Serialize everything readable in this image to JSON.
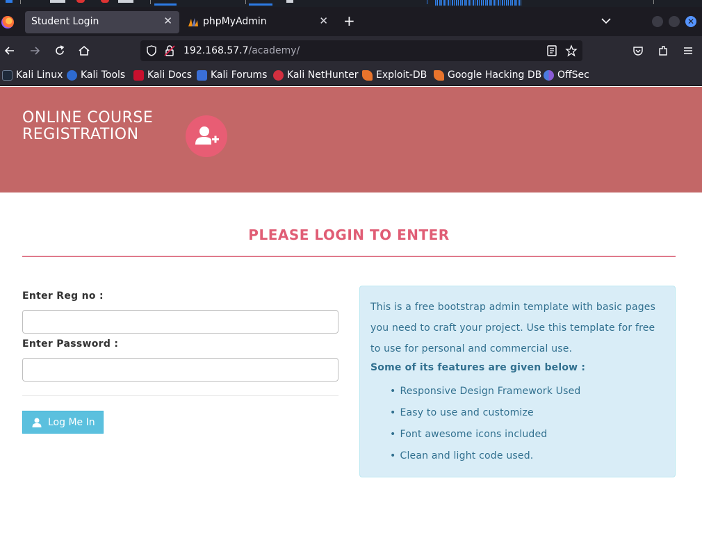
{
  "browser": {
    "tabs": [
      {
        "label": "Student Login",
        "active": true
      },
      {
        "label": "phpMyAdmin",
        "active": false
      }
    ],
    "url_host": "192.168.57.7",
    "url_path": "/academy/",
    "bookmarks": [
      {
        "label": "Kali Linux",
        "icon": "kali-dragon-icon"
      },
      {
        "label": "Kali Tools",
        "icon": "kali-tools-icon"
      },
      {
        "label": "Kali Docs",
        "icon": "kali-docs-icon"
      },
      {
        "label": "Kali Forums",
        "icon": "kali-forums-icon"
      },
      {
        "label": "Kali NetHunter",
        "icon": "kali-nethunter-icon"
      },
      {
        "label": "Exploit-DB",
        "icon": "exploit-db-icon"
      },
      {
        "label": "Google Hacking DB",
        "icon": "ghdb-icon"
      },
      {
        "label": "OffSec",
        "icon": "offsec-icon"
      }
    ]
  },
  "site": {
    "brand": "ONLINE COURSE REGISTRATION",
    "brand_line1": "ONLINE COURSE",
    "brand_line2": "REGISTRATION",
    "header_color": "#c36767",
    "accent_color": "#e05d75"
  },
  "login": {
    "heading": "PLEASE LOGIN TO ENTER",
    "regno_label": "Enter Reg no :",
    "regno_value": "",
    "password_label": "Enter Password :",
    "password_value": "",
    "button_label": "Log Me In"
  },
  "info": {
    "paragraph": "This is a free bootstrap admin template with basic pages you need to craft your project. Use this template for free to use for personal and commercial use.",
    "features_title": "Some of its features are given below :",
    "features": [
      "Responsive Design Framework Used",
      "Easy to use and customize",
      "Font awesome icons included",
      "Clean and light code used."
    ]
  }
}
